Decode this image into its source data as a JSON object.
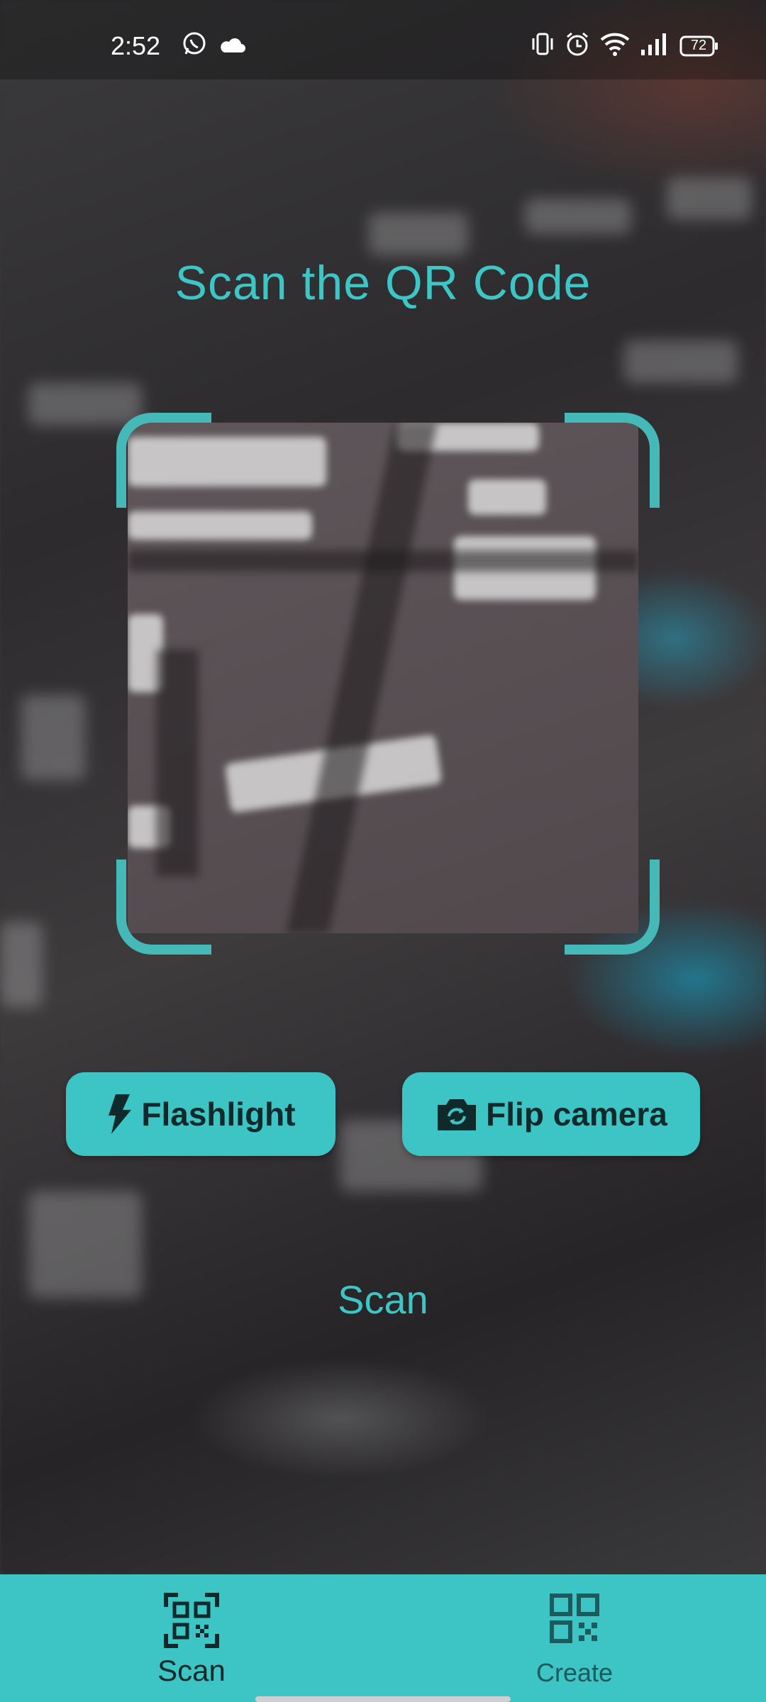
{
  "status_bar": {
    "time": "2:52",
    "battery": "72",
    "left_icons": [
      "whatsapp-icon",
      "cloud-icon"
    ],
    "right_icons": [
      "vibrate-icon",
      "alarm-icon",
      "wifi-icon",
      "signal-icon",
      "battery-icon"
    ]
  },
  "header": {
    "title": "Scan the QR Code"
  },
  "controls": {
    "flashlight_label": "Flashlight",
    "flip_camera_label": "Flip camera"
  },
  "result": {
    "text": "Scan"
  },
  "bottom_nav": {
    "items": [
      {
        "label": "Scan",
        "icon": "qr-scan-icon",
        "active": true
      },
      {
        "label": "Create",
        "icon": "qr-code-icon",
        "active": false
      }
    ]
  },
  "colors": {
    "accent": "#3dc4c4",
    "title_text": "#3cc6c6",
    "frame": "#45b8b8",
    "dark_text": "#10292b"
  }
}
